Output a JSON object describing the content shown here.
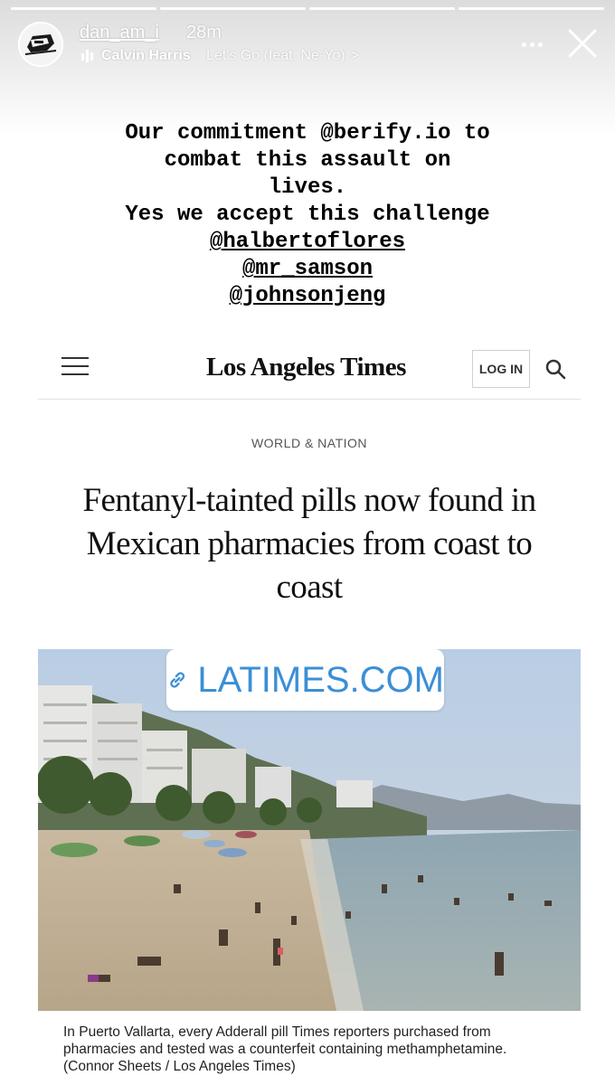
{
  "story": {
    "username": "dan_am_i",
    "time_ago": "28m",
    "music": {
      "artist": "Calvin Harris",
      "separator": "·",
      "track": "Let's Go (feat. Ne-Yo)",
      "chevron": ">"
    },
    "segments": 4,
    "icons": {
      "avatar": "avatar-logo",
      "music": "music-bars-icon",
      "more": "more-dots-icon",
      "close": "close-icon"
    }
  },
  "caption": {
    "lines": [
      "Our commitment @berify.io to",
      "combat this assault on",
      "lives.",
      "Yes we accept this challenge"
    ],
    "mentions": [
      "@halbertoflores",
      "@mr_samson",
      "@johnsonjeng"
    ]
  },
  "article": {
    "publication": "Los Angeles Times",
    "login_label": "LOG IN",
    "section": "WORLD & NATION",
    "headline": "Fentanyl-tainted pills now found in Mexican pharmacies from coast to coast",
    "link_sticker": "LATIMES.COM",
    "photo_caption": "In Puerto Vallarta, every Adderall pill Times reporters purchased from pharmacies and tested was a counterfeit containing methamphetamine.  (Connor Sheets / Los Angeles Times)",
    "icons": {
      "menu": "hamburger-menu-icon",
      "search": "search-icon",
      "link": "link-icon"
    }
  },
  "colors": {
    "link_blue": "#3b8fd6",
    "text_dark": "#111111",
    "header_white": "#ffffff"
  }
}
